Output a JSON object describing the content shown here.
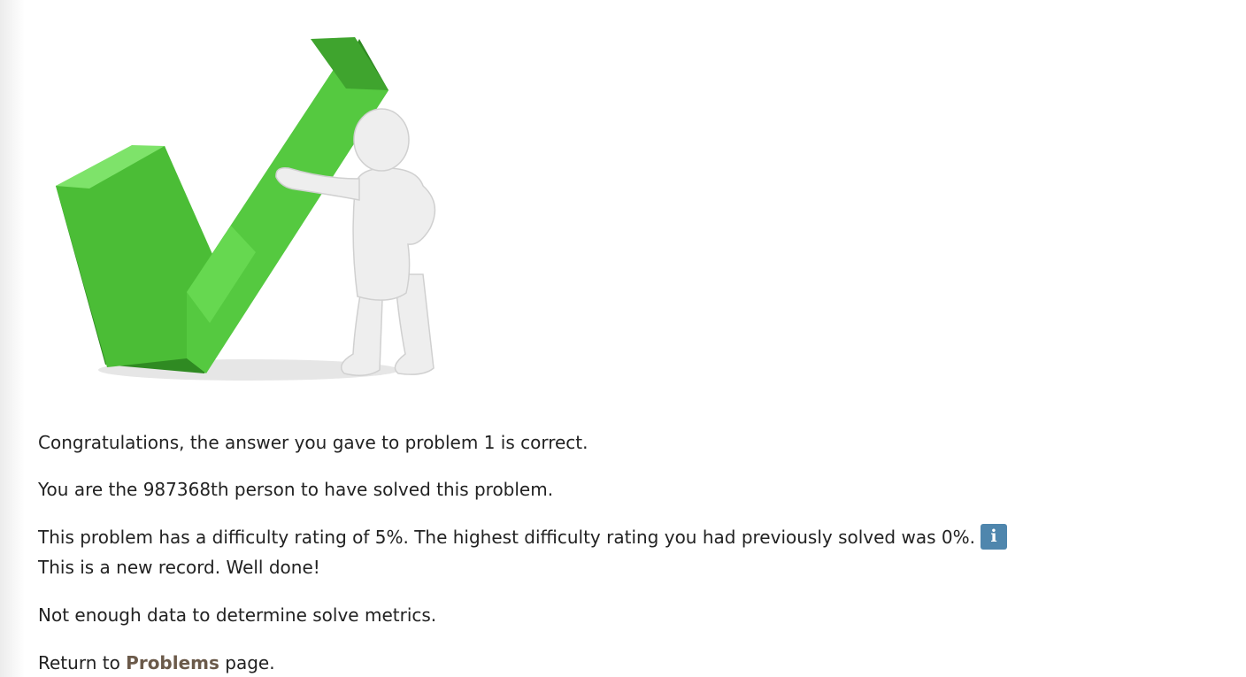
{
  "illustration": {
    "icon": "check-mark-with-figure-icon",
    "colors": {
      "check_light": "#5fd44a",
      "check_dark": "#2f8a22",
      "figure": "#e8e8e8"
    }
  },
  "messages": {
    "congrats": "Congratulations, the answer you gave to problem 1 is correct.",
    "solver_rank": "You are the 987368th person to have solved this problem.",
    "difficulty": "This problem has a difficulty rating of 5%. The highest difficulty rating you had previously solved was 0%.",
    "info_icon_glyph": "i",
    "record": "This is a new record. Well done!",
    "metrics": "Not enough data to determine solve metrics.",
    "return_prefix": "Return to",
    "return_link": "Problems",
    "return_suffix": "page."
  },
  "colors": {
    "text": "#222222",
    "link": "#6b5a4a",
    "info_badge": "#4f86ad"
  }
}
